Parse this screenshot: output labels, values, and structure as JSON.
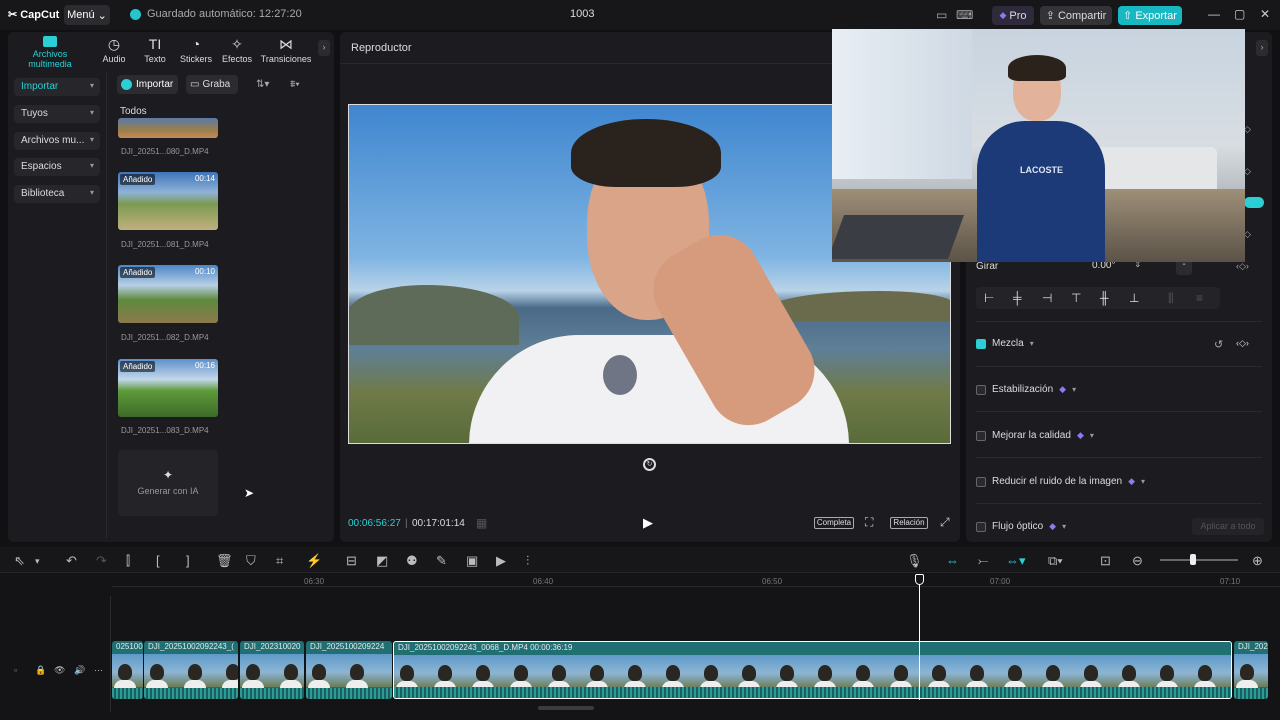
{
  "topbar": {
    "app_name": "CapCut",
    "menu_label": "Menú",
    "autosave": "Guardado automático: 12:27:20",
    "project_name": "1003",
    "pro_label": "Pro",
    "share_label": "Compartir",
    "export_label": "Exportar"
  },
  "media_tabs": [
    {
      "label": "Archivos multimedia"
    },
    {
      "label": "Audio"
    },
    {
      "label": "Texto"
    },
    {
      "label": "Stickers"
    },
    {
      "label": "Efectos"
    },
    {
      "label": "Transiciones"
    }
  ],
  "sidebar": {
    "items": [
      {
        "label": "Importar"
      },
      {
        "label": "Tuyos"
      },
      {
        "label": "Archivos mu..."
      },
      {
        "label": "Espacios"
      },
      {
        "label": "Biblioteca"
      }
    ]
  },
  "media_toolbar": {
    "import_label": "Importar",
    "record_label": "Graba"
  },
  "media": {
    "section_label": "Todos",
    "items": [
      {
        "name": "DJI_20251...080_D.MP4",
        "badge": "",
        "duration": ""
      },
      {
        "name": "DJI_20251...081_D.MP4",
        "badge": "Añadido",
        "duration": "00:14"
      },
      {
        "name": "DJI_20251...082_D.MP4",
        "badge": "Añadido",
        "duration": "00:10"
      },
      {
        "name": "DJI_20251...083_D.MP4",
        "badge": "Añadido",
        "duration": "00:16"
      }
    ],
    "generate_label": "Generar con IA"
  },
  "player": {
    "title": "Reproductor",
    "current_time": "00:06:56:27",
    "total_time": "00:17:01:14",
    "full_label": "Completa",
    "ratio_label": "Relación"
  },
  "properties": {
    "rotate_label": "Girar",
    "rotate_value": "0.00°",
    "blend_label": "Mezcla",
    "stabilize_label": "Estabilización",
    "enhance_label": "Mejorar la calidad",
    "denoise_label": "Reducir el ruido de la imagen",
    "optical_flow_label": "Flujo óptico",
    "apply_all_label": "Aplicar a todo"
  },
  "timeline": {
    "ruler": [
      "06:30",
      "06:40",
      "06:50",
      "07:00",
      "07:10"
    ],
    "clips": [
      {
        "label": "025100"
      },
      {
        "label": "DJI_20251002092243_("
      },
      {
        "label": "DJI_202310020"
      },
      {
        "label": "DJI_2025100209224"
      },
      {
        "label": "DJI_20251002092243_0068_D.MP4   00:00:36:19"
      },
      {
        "label": "DJI_202"
      }
    ]
  },
  "colors": {
    "accent": "#18b8c3",
    "clip": "#1f6f73",
    "selected_border": "#ffffff"
  }
}
